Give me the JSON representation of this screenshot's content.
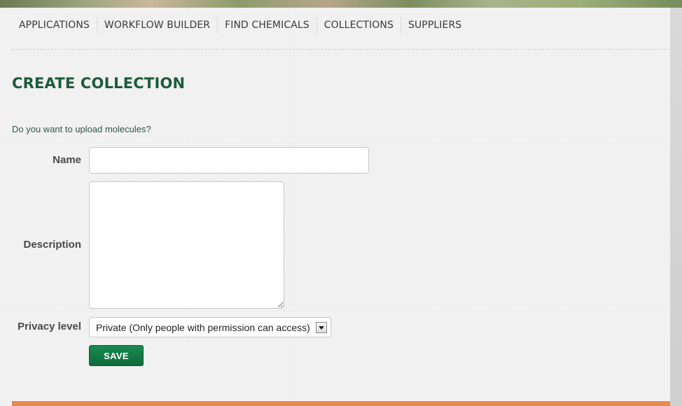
{
  "nav": {
    "items": [
      {
        "label": "APPLICATIONS"
      },
      {
        "label": "WORKFLOW BUILDER"
      },
      {
        "label": "FIND CHEMICALS"
      },
      {
        "label": "COLLECTIONS"
      },
      {
        "label": "SUPPLIERS"
      }
    ]
  },
  "page": {
    "title": "CREATE COLLECTION",
    "upload_prompt": "Do you want to upload molecules?"
  },
  "form": {
    "name_label": "Name",
    "name_value": "",
    "description_label": "Description",
    "description_value": "",
    "privacy_label": "Privacy level",
    "privacy_selected": "Private (Only people with permission can access)",
    "save_label": "SAVE"
  },
  "colors": {
    "title_green": "#1d5b3c",
    "button_green": "#0f6b3a",
    "footer_orange": "#e58a4c"
  }
}
